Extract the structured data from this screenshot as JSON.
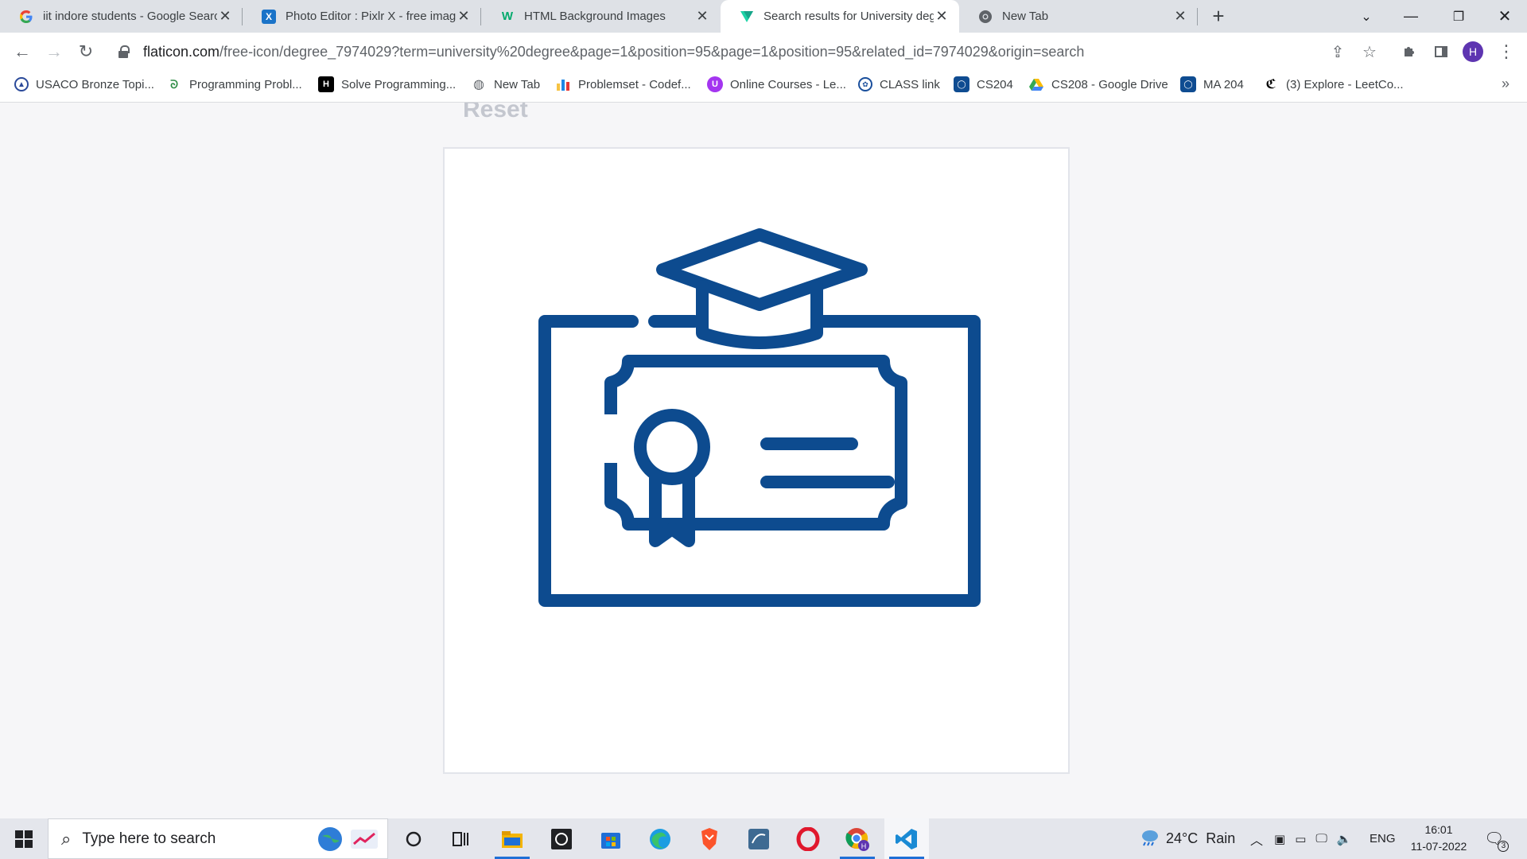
{
  "tabs": [
    {
      "title": "iit indore students - Google Search",
      "favicon": "google-icon",
      "active": false
    },
    {
      "title": "Photo Editor : Pixlr X - free image editing",
      "favicon": "pixlr-icon",
      "active": false
    },
    {
      "title": "HTML Background Images",
      "favicon": "w3schools-icon",
      "active": false
    },
    {
      "title": "Search results for University degree",
      "favicon": "flaticon-icon",
      "active": true
    },
    {
      "title": "New Tab",
      "favicon": "chrome-icon",
      "active": false
    }
  ],
  "address_bar": {
    "host": "flaticon.com",
    "path": "/free-icon/degree_7974029?term=university%20degree&page=1&position=95&page=1&position=95&related_id=7974029&origin=search"
  },
  "profile_initial": "H",
  "bookmarks": [
    {
      "label": "USACO Bronze Topi...",
      "icon": "usaco-icon"
    },
    {
      "label": "Programming Probl...",
      "icon": "geeksforgeeks-icon"
    },
    {
      "label": "Solve Programming...",
      "icon": "hackerrank-icon"
    },
    {
      "label": "New Tab",
      "icon": "globe-icon"
    },
    {
      "label": "Problemset - Codef...",
      "icon": "codeforces-icon"
    },
    {
      "label": "Online Courses - Le...",
      "icon": "udemy-icon"
    },
    {
      "label": "CLASS link",
      "icon": "class-icon"
    },
    {
      "label": "CS204",
      "icon": "moodle-icon"
    },
    {
      "label": "CS208 - Google Drive",
      "icon": "google-drive-icon"
    },
    {
      "label": "MA 204",
      "icon": "moodle-icon"
    },
    {
      "label": "(3) Explore - LeetCo...",
      "icon": "leetcode-icon"
    }
  ],
  "page": {
    "reset_label": "Reset",
    "preview_icon": "degree-certificate-icon",
    "icon_color": "#0d4b8f"
  },
  "taskbar": {
    "search_placeholder": "Type here to search",
    "weather": "24°C  Rain",
    "language": "ENG",
    "time": "16:01",
    "date": "11-07-2022",
    "notifications_count": "3"
  }
}
